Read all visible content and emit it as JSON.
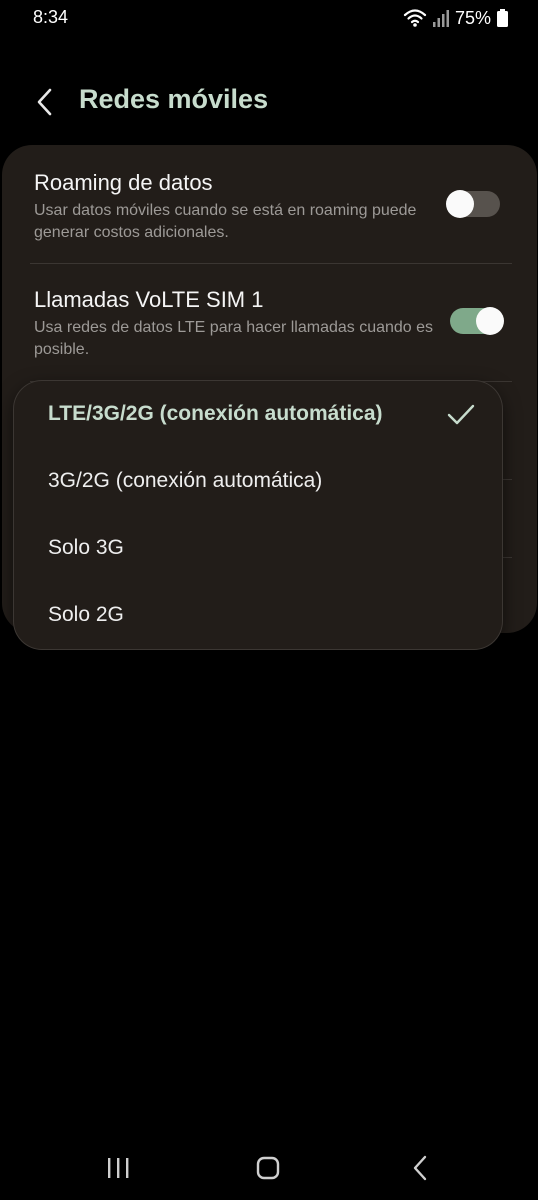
{
  "status_bar": {
    "time": "8:34",
    "battery_percent": "75%",
    "icons": [
      "wifi-icon",
      "signal-icon",
      "battery-icon"
    ]
  },
  "header": {
    "title": "Redes móviles",
    "back_icon": "back-arrow-icon"
  },
  "settings": {
    "roaming": {
      "title": "Roaming de datos",
      "description": "Usar datos móviles cuando se está en roaming puede generar costos adicionales.",
      "enabled": false
    },
    "volte": {
      "title": "Llamadas VoLTE SIM 1",
      "description": "Usa redes de datos LTE para hacer llamadas cuando es posible.",
      "enabled": true
    }
  },
  "network_mode_popup": {
    "options": [
      {
        "label": "LTE/3G/2G (conexión automática)",
        "selected": true
      },
      {
        "label": "3G/2G (conexión automática)",
        "selected": false
      },
      {
        "label": "Solo 3G",
        "selected": false
      },
      {
        "label": "Solo 2G",
        "selected": false
      }
    ]
  },
  "nav_bar": {
    "icons": [
      "recents-icon",
      "home-icon",
      "back-icon"
    ]
  },
  "colors": {
    "accent": "#c7dccd",
    "toggle_on": "#7fa98a",
    "toggle_off": "#57524d",
    "card_bg": "#221d19",
    "background": "#000000"
  }
}
